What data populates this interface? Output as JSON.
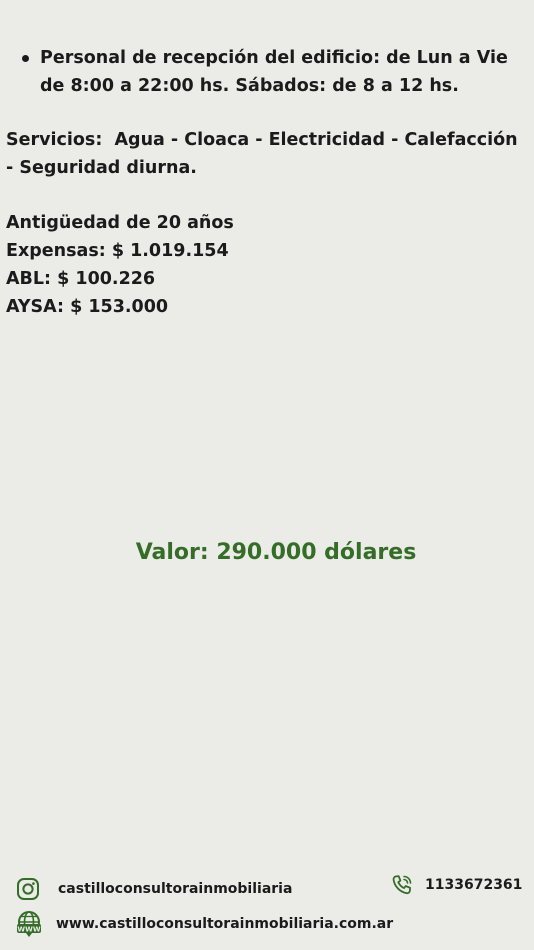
{
  "listing": {
    "bullets": [
      "Personal de recepción del edificio: de Lun a Vie de 8:00 a 22:00 hs. Sábados: de 8 a 12 hs."
    ],
    "servicios": "Servicios:  Agua - Cloaca - Electricidad - Calefacción - Seguridad diurna.",
    "facts": [
      "Antigüedad de 20 años",
      "Expensas: $ 1.019.154",
      "ABL: $ 100.226",
      "AYSA: $ 153.000"
    ],
    "price": "Valor: 290.000 dólares"
  },
  "footer": {
    "instagram_handle": "castilloconsultorainmobiliaria",
    "website": "www.castilloconsultorainmobiliaria.com.ar",
    "phone": "1133672361",
    "icons": {
      "instagram": "instagram-icon",
      "website": "www-globe-icon",
      "phone": "phone-icon"
    },
    "icon_color": "#356d28"
  },
  "colors": {
    "background": "#ebebe7",
    "text": "#1b1b1b",
    "accent": "#356d28"
  }
}
